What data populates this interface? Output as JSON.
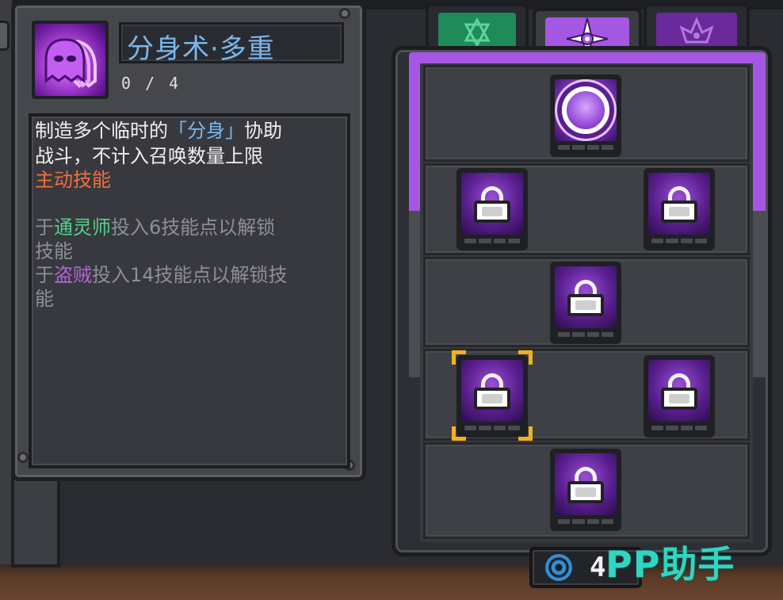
{
  "skill": {
    "title": "分身术·多重",
    "level": "0 / 4",
    "icon": "purple-ghost-clones-icon"
  },
  "description": {
    "line1_prefix": "制造多个临时的",
    "line1_highlight": "「分身」",
    "line1_suffix": "协助",
    "line2": "战斗，不计入召唤数量上限",
    "type_label": "主动技能",
    "req1_prefix": "于",
    "req1_class": "通灵师",
    "req1_suffix": "投入6技能点以解锁",
    "req1_cont": "技能",
    "req2_prefix": "于",
    "req2_class": "盗贼",
    "req2_suffix": "投入14技能点以解锁技",
    "req2_cont": "能"
  },
  "tabs": [
    {
      "name": "necromancer-tab",
      "icon": "star-icon",
      "active": false
    },
    {
      "name": "rogue-tab",
      "icon": "shuriken-icon",
      "active": true
    },
    {
      "name": "third-tab",
      "icon": "crest-icon",
      "active": false
    }
  ],
  "tree": {
    "nodes": [
      {
        "tier": 1,
        "state": "unlocked",
        "icon": "clone-skill-icon"
      },
      {
        "tier": 2,
        "state": "locked",
        "icon": "lock-icon"
      },
      {
        "tier": 2,
        "state": "locked",
        "icon": "lock-icon"
      },
      {
        "tier": 3,
        "state": "locked",
        "icon": "lock-icon"
      },
      {
        "tier": 4,
        "state": "locked",
        "icon": "lock-icon",
        "selected": true
      },
      {
        "tier": 4,
        "state": "locked",
        "icon": "lock-icon"
      },
      {
        "tier": 5,
        "state": "locked",
        "icon": "lock-icon"
      }
    ]
  },
  "currency": {
    "icon": "swirl-icon",
    "value": "4"
  },
  "watermark": "PP助手",
  "colors": {
    "accent_purple": "#a557e4",
    "necromancer_green": "#1f8a5a",
    "title_blue": "#78b8f0",
    "active_skill_orange": "#f07040",
    "necromancer_text": "#52d08a",
    "rogue_text": "#b464d8",
    "selection_gold": "#f2b21c",
    "watermark_teal": "#2fd6c0"
  }
}
